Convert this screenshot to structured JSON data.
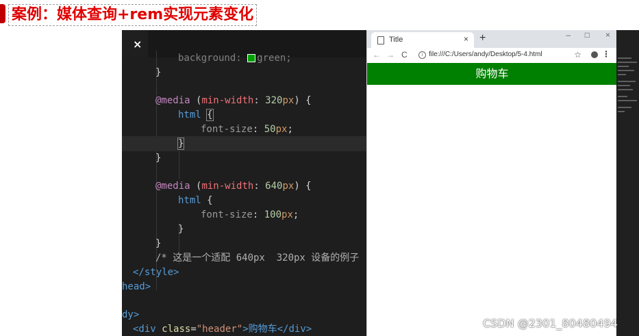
{
  "slide": {
    "title": "案例：媒体查询+rem实现元素变化"
  },
  "editor": {
    "tab_close": "×",
    "lines": [
      {
        "id": "l0",
        "text": "background: "
      },
      {
        "id": "l0b",
        "text": "green;"
      },
      {
        "id": "l1",
        "text": "}"
      },
      {
        "id": "l2a",
        "text": "@media"
      },
      {
        "id": "l2b",
        "text": "("
      },
      {
        "id": "l2c",
        "text": "min-width"
      },
      {
        "id": "l2d",
        "text": ": "
      },
      {
        "id": "l2e",
        "text": "320"
      },
      {
        "id": "l2f",
        "text": "px"
      },
      {
        "id": "l2g",
        "text": ") {"
      },
      {
        "id": "l3a",
        "text": "html"
      },
      {
        "id": "l3b",
        "text": "{"
      },
      {
        "id": "l4a",
        "text": "font-size"
      },
      {
        "id": "l4b",
        "text": ": "
      },
      {
        "id": "l4c",
        "text": "50"
      },
      {
        "id": "l4d",
        "text": "px"
      },
      {
        "id": "l4e",
        "text": ";"
      },
      {
        "id": "l5",
        "text": "}"
      },
      {
        "id": "l6",
        "text": "}"
      },
      {
        "id": "l7a",
        "text": "@media"
      },
      {
        "id": "l7b",
        "text": "("
      },
      {
        "id": "l7c",
        "text": "min-width"
      },
      {
        "id": "l7d",
        "text": ": "
      },
      {
        "id": "l7e",
        "text": "640"
      },
      {
        "id": "l7f",
        "text": "px"
      },
      {
        "id": "l7g",
        "text": ") {"
      },
      {
        "id": "l8a",
        "text": "html"
      },
      {
        "id": "l8b",
        "text": " {"
      },
      {
        "id": "l9a",
        "text": "font-size"
      },
      {
        "id": "l9b",
        "text": ": "
      },
      {
        "id": "l9c",
        "text": "100"
      },
      {
        "id": "l9d",
        "text": "px"
      },
      {
        "id": "l9e",
        "text": ";"
      },
      {
        "id": "l10",
        "text": "}"
      },
      {
        "id": "l11",
        "text": "}"
      },
      {
        "id": "l12",
        "text": "/* 这是一个适配 640px  320px 设备的例子"
      },
      {
        "id": "l13",
        "text": "</style>"
      },
      {
        "id": "l14",
        "text": "head>"
      },
      {
        "id": "l15",
        "text": "dy>"
      },
      {
        "id": "l16a",
        "text": "<div "
      },
      {
        "id": "l16b",
        "text": "class"
      },
      {
        "id": "l16c",
        "text": "="
      },
      {
        "id": "l16d",
        "text": "\"header\""
      },
      {
        "id": "l16e",
        "text": ">购物车</div>"
      }
    ]
  },
  "browser": {
    "tab_title": "Title",
    "tab_close": "×",
    "new_tab": "+",
    "win_min": "–",
    "win_max": "□",
    "win_close": "×",
    "back": "←",
    "forward": "→",
    "reload": "C",
    "address": "file:///C:/Users/andy/Desktop/5-4.html",
    "star": "☆",
    "menu": "⋮",
    "page_header_text": "购物车",
    "colors": {
      "header_bg": "#008000",
      "header_text": "#ffffff"
    }
  },
  "watermark": "CSDN @2301_80480494"
}
